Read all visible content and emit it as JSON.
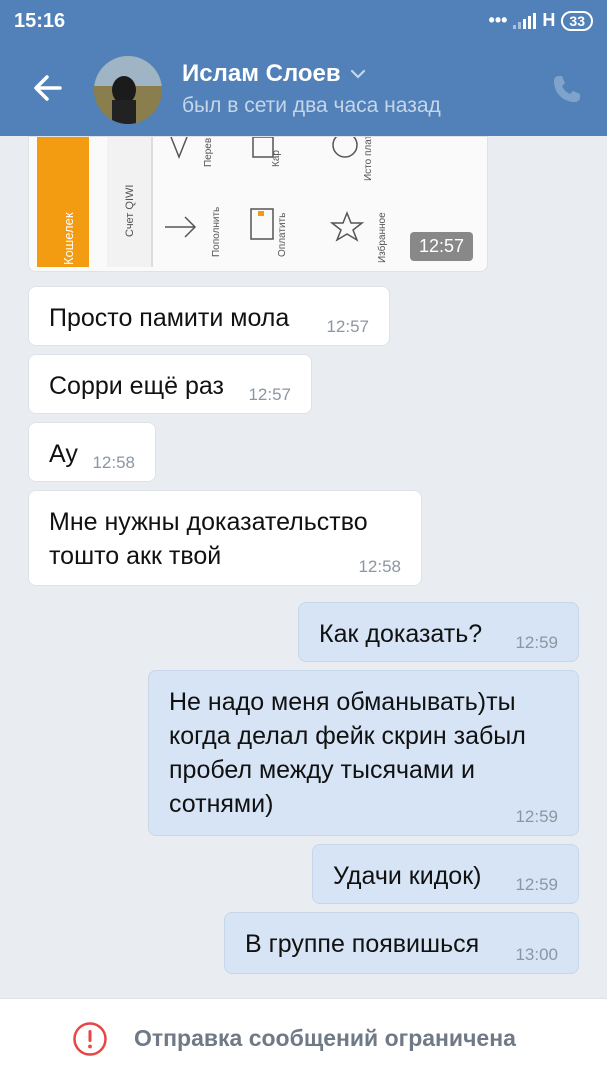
{
  "status_bar": {
    "time": "15:16",
    "network": "H",
    "battery": "33"
  },
  "header": {
    "name": "Ислам Слоев",
    "last_seen": "был в сети два часа назад",
    "accent_color": "#5181b8"
  },
  "image_message": {
    "time": "12:57",
    "screenshot_labels": [
      "Кошелек",
      "Счет QIWI",
      "Пополнить",
      "Перев",
      "Оплатить",
      "Кар",
      "Избранное",
      "Исто плате"
    ]
  },
  "messages": [
    {
      "direction": "in",
      "text": "Просто памити мола",
      "time": "12:57"
    },
    {
      "direction": "in",
      "text": "Сорри ещё раз",
      "time": "12:57"
    },
    {
      "direction": "in",
      "text": "Ау",
      "time": "12:58"
    },
    {
      "direction": "in",
      "text_lines": [
        "Мне нужны доказательство",
        "тошто акк твой"
      ],
      "time": "12:58"
    },
    {
      "direction": "out",
      "text": "Как доказать?",
      "time": "12:59"
    },
    {
      "direction": "out",
      "text_lines": [
        "Не надо меня обманывать)ты",
        "когда делал фейк скрин забыл",
        "пробел между тысячами и",
        "сотнями)"
      ],
      "time": "12:59"
    },
    {
      "direction": "out",
      "text": "Удачи кидок)",
      "time": "12:59"
    },
    {
      "direction": "out",
      "text": "В группе появишься",
      "time": "13:00"
    }
  ],
  "footer": {
    "notice": "Отправка сообщений ограничена"
  }
}
